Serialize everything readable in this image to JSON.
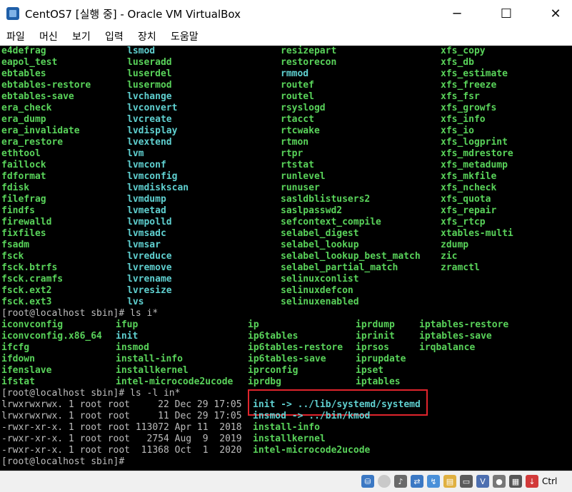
{
  "window": {
    "title": "CentOS7 [실행 중] - Oracle VM VirtualBox",
    "minimize": "─",
    "maximize": "☐",
    "close": "✕"
  },
  "menubar": [
    "파일",
    "머신",
    "보기",
    "입력",
    "장치",
    "도움말"
  ],
  "terminal": {
    "colors": {
      "background": "#000000",
      "executable": "#59d35a",
      "symlink": "#5fd0d0",
      "text": "#bdbdbd",
      "highlight_box": "#e0242c"
    },
    "columns_top": [
      [
        "e4defrag",
        "eapol_test",
        "ebtables",
        "ebtables-restore",
        "ebtables-save",
        "era_check",
        "era_dump",
        "era_invalidate",
        "era_restore",
        "ethtool",
        "faillock",
        "fdformat",
        "fdisk",
        "filefrag",
        "findfs",
        "firewalld",
        "fixfiles",
        "fsadm",
        "fsck",
        "fsck.btrfs",
        "fsck.cramfs",
        "fsck.ext2",
        "fsck.ext3"
      ],
      [
        "lsmod",
        "luseradd",
        "luserdel",
        "lusermod",
        "lvchange",
        "lvconvert",
        "lvcreate",
        "lvdisplay",
        "lvextend",
        "lvm",
        "lvmconf",
        "lvmconfig",
        "lvmdiskscan",
        "lvmdump",
        "lvmetad",
        "lvmpolld",
        "lvmsadc",
        "lvmsar",
        "lvreduce",
        "lvremove",
        "lvrename",
        "lvresize",
        "lvs"
      ],
      [
        "resizepart",
        "restorecon",
        "rmmod",
        "routef",
        "routel",
        "rsyslogd",
        "rtacct",
        "rtcwake",
        "rtmon",
        "rtpr",
        "rtstat",
        "runlevel",
        "runuser",
        "sasldblistusers2",
        "saslpasswd2",
        "sefcontext_compile",
        "selabel_digest",
        "selabel_lookup",
        "selabel_lookup_best_match",
        "selabel_partial_match",
        "selinuxconlist",
        "selinuxdefcon",
        "selinuxenabled"
      ],
      [
        "xfs_copy",
        "xfs_db",
        "xfs_estimate",
        "xfs_freeze",
        "xfs_fsr",
        "xfs_growfs",
        "xfs_info",
        "xfs_io",
        "xfs_logprint",
        "xfs_mdrestore",
        "xfs_metadump",
        "xfs_mkfile",
        "xfs_ncheck",
        "xfs_quota",
        "xfs_repair",
        "xfs_rtcp",
        "xtables-multi",
        "zdump",
        "zic",
        "zramctl"
      ]
    ],
    "top_symlinks": [
      "rmmod",
      "lvm",
      "lvmconf",
      "lvmconfig",
      "lvmdiskscan",
      "lvmdump",
      "lvmetad",
      "lvmpolld",
      "lvmsadc",
      "lvmsar",
      "lvreduce",
      "lvremove",
      "lvrename",
      "lvresize",
      "lvs",
      "lvchange",
      "lvconvert",
      "lvcreate",
      "lvdisplay",
      "lvextend",
      "lsmod"
    ],
    "prompt1": "[root@localhost sbin]# ls i*",
    "columns_mid": [
      [
        "iconvconfig",
        "iconvconfig.x86_64",
        "ifcfg",
        "ifdown",
        "ifenslave",
        "ifstat"
      ],
      [
        "ifup",
        "init",
        "insmod",
        "install-info",
        "installkernel",
        "intel-microcode2ucode"
      ],
      [
        "ip",
        "ip6tables",
        "ip6tables-restore",
        "ip6tables-save",
        "iprconfig",
        "iprdbg"
      ],
      [
        "iprdump",
        "iprinit",
        "iprsos",
        "iprupdate",
        "ipset",
        "iptables"
      ],
      [
        "iptables-restore",
        "iptables-save",
        "irqbalance"
      ]
    ],
    "prompt2": "[root@localhost sbin]# ls -l in*",
    "ls_rows": [
      {
        "info": "lrwxrwxrwx. 1 root root     22 Dec 29 17:05",
        "name": "init -> ../lib/systemd/systemd",
        "type": "symlink"
      },
      {
        "info": "lrwxrwxrwx. 1 root root     11 Dec 29 17:05",
        "name": "insmod -> ../bin/kmod",
        "type": "symlink"
      },
      {
        "info": "-rwxr-xr-x. 1 root root 113072 Apr 11  2018",
        "name": "install-info",
        "type": "exec"
      },
      {
        "info": "-rwxr-xr-x. 1 root root   2754 Aug  9  2019",
        "name": "installkernel",
        "type": "exec"
      },
      {
        "info": "-rwxr-xr-x. 1 root root  11368 Oct  1  2020",
        "name": "intel-microcode2ucode",
        "type": "exec"
      }
    ],
    "prompt3": "[root@localhost sbin]#"
  },
  "statusbar": {
    "icons": [
      "hard-disk-icon",
      "optical-drive-icon",
      "audio-icon",
      "network-icon",
      "usb-icon",
      "shared-folder-icon",
      "display-icon",
      "video-capture-icon",
      "recording-icon",
      "cpu-icon",
      "mouse-integration-icon",
      "host-key-icon"
    ],
    "host_key": "Ctrl"
  }
}
